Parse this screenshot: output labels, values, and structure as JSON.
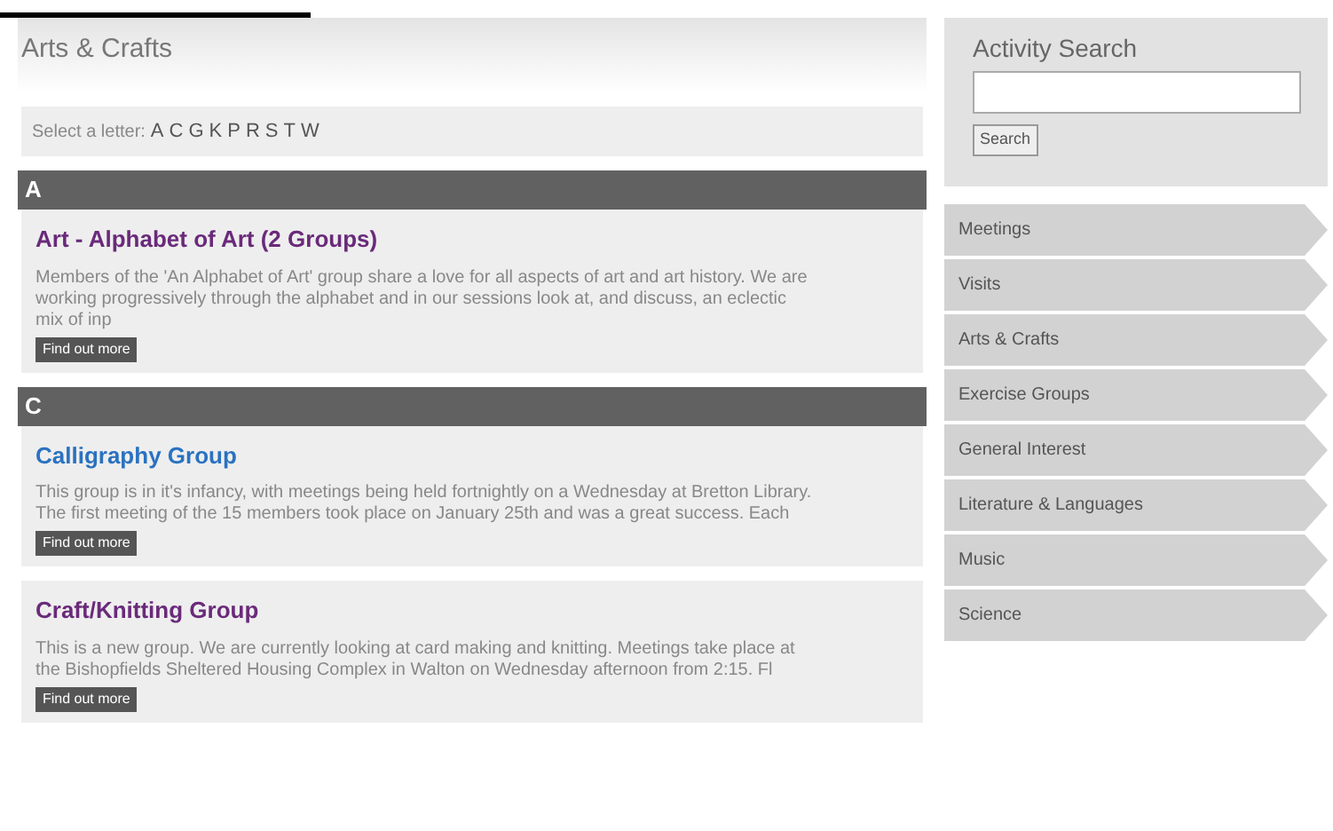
{
  "page_title": "Arts & Crafts",
  "letter_bar": {
    "label": "Select a letter:",
    "letters": [
      "A",
      "C",
      "G",
      "K",
      "P",
      "R",
      "S",
      "T",
      "W"
    ]
  },
  "sections": [
    {
      "letter": "A",
      "items": [
        {
          "title": "Art - Alphabet of Art (2 Groups)",
          "visited": true,
          "description": "Members of the 'An Alphabet of Art' group share a love for all aspects of art and art history. We are working progressively through the alphabet and in our sessions look at, and discuss, an eclectic mix of inp",
          "button": "Find out more"
        }
      ]
    },
    {
      "letter": "C",
      "items": [
        {
          "title": "Calligraphy Group",
          "visited": false,
          "description": "This group is in it's infancy, with meetings being held fortnightly on a Wednesday at Bretton Library.  The first meeting of the 15 members took place on January 25th and was a great success.  Each",
          "button": "Find out more"
        },
        {
          "title": "Craft/Knitting Group",
          "visited": true,
          "description": "This is a new group.  We are currently looking at card making and knitting. Meetings take place at the Bishopfields Sheltered Housing Complex in Walton on Wednesday afternoon from 2:15.  Fl",
          "button": "Find out more"
        }
      ]
    }
  ],
  "search": {
    "title": "Activity Search",
    "button": "Search"
  },
  "categories": [
    "Meetings",
    "Visits",
    "Arts & Crafts",
    "Exercise Groups",
    "General Interest",
    "Literature & Languages",
    "Music",
    "Science"
  ]
}
